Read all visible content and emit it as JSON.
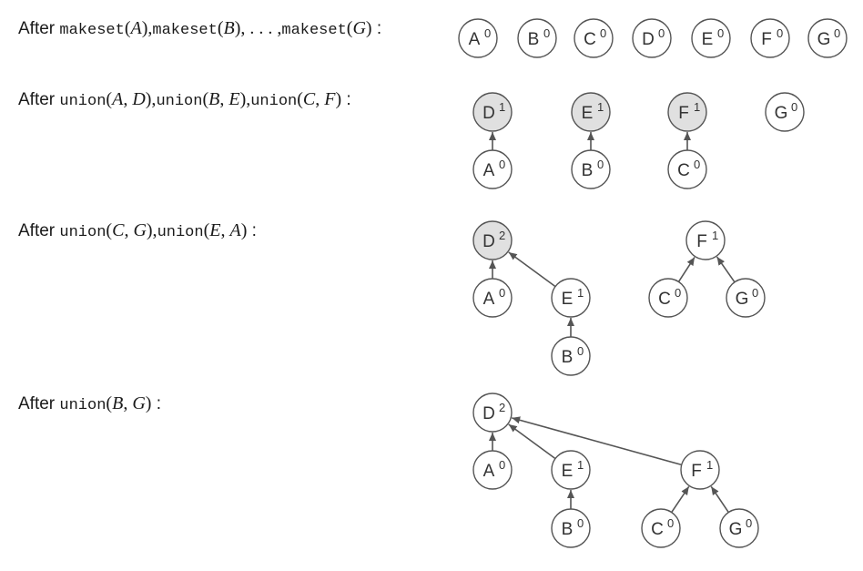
{
  "stages": [
    {
      "label_parts": [
        {
          "t": "After ",
          "s": "w"
        },
        {
          "t": "makeset",
          "s": "m"
        },
        {
          "t": "(",
          "s": "p"
        },
        {
          "t": "A",
          "s": "v"
        },
        {
          "t": "),",
          "s": "p"
        },
        {
          "t": "makeset",
          "s": "m"
        },
        {
          "t": "(",
          "s": "p"
        },
        {
          "t": "B",
          "s": "v"
        },
        {
          "t": "), . . . ,",
          "s": "p"
        },
        {
          "t": "makeset",
          "s": "m"
        },
        {
          "t": "(",
          "s": "p"
        },
        {
          "t": "G",
          "s": "v"
        },
        {
          "t": ")",
          "s": "p"
        },
        {
          "t": " :",
          "s": "w"
        }
      ],
      "nodes": [
        {
          "id": "A",
          "letter": "A",
          "rank": "0",
          "shaded": false
        },
        {
          "id": "B",
          "letter": "B",
          "rank": "0",
          "shaded": false
        },
        {
          "id": "C",
          "letter": "C",
          "rank": "0",
          "shaded": false
        },
        {
          "id": "D",
          "letter": "D",
          "rank": "0",
          "shaded": false
        },
        {
          "id": "E",
          "letter": "E",
          "rank": "0",
          "shaded": false
        },
        {
          "id": "F",
          "letter": "F",
          "rank": "0",
          "shaded": false
        },
        {
          "id": "G",
          "letter": "G",
          "rank": "0",
          "shaded": false
        }
      ],
      "edges": []
    },
    {
      "label_parts": [
        {
          "t": "After ",
          "s": "w"
        },
        {
          "t": "union",
          "s": "m"
        },
        {
          "t": "(",
          "s": "p"
        },
        {
          "t": "A",
          "s": "v"
        },
        {
          "t": ", ",
          "s": "p"
        },
        {
          "t": "D",
          "s": "v"
        },
        {
          "t": "),",
          "s": "p"
        },
        {
          "t": "union",
          "s": "m"
        },
        {
          "t": "(",
          "s": "p"
        },
        {
          "t": "B",
          "s": "v"
        },
        {
          "t": ", ",
          "s": "p"
        },
        {
          "t": "E",
          "s": "v"
        },
        {
          "t": "),",
          "s": "p"
        },
        {
          "t": "union",
          "s": "m"
        },
        {
          "t": "(",
          "s": "p"
        },
        {
          "t": "C",
          "s": "v"
        },
        {
          "t": ", ",
          "s": "p"
        },
        {
          "t": "F",
          "s": "v"
        },
        {
          "t": ")",
          "s": "p"
        },
        {
          "t": " :",
          "s": "w"
        }
      ],
      "nodes": [
        {
          "id": "D",
          "letter": "D",
          "rank": "1",
          "shaded": true
        },
        {
          "id": "E",
          "letter": "E",
          "rank": "1",
          "shaded": true
        },
        {
          "id": "F",
          "letter": "F",
          "rank": "1",
          "shaded": true
        },
        {
          "id": "G",
          "letter": "G",
          "rank": "0",
          "shaded": false
        },
        {
          "id": "A",
          "letter": "A",
          "rank": "0",
          "shaded": false
        },
        {
          "id": "B",
          "letter": "B",
          "rank": "0",
          "shaded": false
        },
        {
          "id": "C",
          "letter": "C",
          "rank": "0",
          "shaded": false
        }
      ],
      "edges": [
        {
          "from": "A",
          "to": "D"
        },
        {
          "from": "B",
          "to": "E"
        },
        {
          "from": "C",
          "to": "F"
        }
      ]
    },
    {
      "label_parts": [
        {
          "t": "After ",
          "s": "w"
        },
        {
          "t": "union",
          "s": "m"
        },
        {
          "t": "(",
          "s": "p"
        },
        {
          "t": "C",
          "s": "v"
        },
        {
          "t": ", ",
          "s": "p"
        },
        {
          "t": "G",
          "s": "v"
        },
        {
          "t": "),",
          "s": "p"
        },
        {
          "t": "union",
          "s": "m"
        },
        {
          "t": "(",
          "s": "p"
        },
        {
          "t": "E",
          "s": "v"
        },
        {
          "t": ", ",
          "s": "p"
        },
        {
          "t": "A",
          "s": "v"
        },
        {
          "t": ")",
          "s": "p"
        },
        {
          "t": " :",
          "s": "w"
        }
      ],
      "nodes": [
        {
          "id": "D",
          "letter": "D",
          "rank": "2",
          "shaded": true
        },
        {
          "id": "A",
          "letter": "A",
          "rank": "0",
          "shaded": false
        },
        {
          "id": "E",
          "letter": "E",
          "rank": "1",
          "shaded": false
        },
        {
          "id": "B",
          "letter": "B",
          "rank": "0",
          "shaded": false
        },
        {
          "id": "F",
          "letter": "F",
          "rank": "1",
          "shaded": false
        },
        {
          "id": "C",
          "letter": "C",
          "rank": "0",
          "shaded": false
        },
        {
          "id": "G",
          "letter": "G",
          "rank": "0",
          "shaded": false
        }
      ],
      "edges": [
        {
          "from": "A",
          "to": "D"
        },
        {
          "from": "E",
          "to": "D"
        },
        {
          "from": "B",
          "to": "E"
        },
        {
          "from": "C",
          "to": "F"
        },
        {
          "from": "G",
          "to": "F"
        }
      ]
    },
    {
      "label_parts": [
        {
          "t": "After ",
          "s": "w"
        },
        {
          "t": "union",
          "s": "m"
        },
        {
          "t": "(",
          "s": "p"
        },
        {
          "t": "B",
          "s": "v"
        },
        {
          "t": ", ",
          "s": "p"
        },
        {
          "t": "G",
          "s": "v"
        },
        {
          "t": ")",
          "s": "p"
        },
        {
          "t": " :",
          "s": "w"
        }
      ],
      "nodes": [
        {
          "id": "D",
          "letter": "D",
          "rank": "2",
          "shaded": false
        },
        {
          "id": "A",
          "letter": "A",
          "rank": "0",
          "shaded": false
        },
        {
          "id": "E",
          "letter": "E",
          "rank": "1",
          "shaded": false
        },
        {
          "id": "B",
          "letter": "B",
          "rank": "0",
          "shaded": false
        },
        {
          "id": "F",
          "letter": "F",
          "rank": "1",
          "shaded": false
        },
        {
          "id": "C",
          "letter": "C",
          "rank": "0",
          "shaded": false
        },
        {
          "id": "G",
          "letter": "G",
          "rank": "0",
          "shaded": false
        }
      ],
      "edges": [
        {
          "from": "A",
          "to": "D"
        },
        {
          "from": "E",
          "to": "D"
        },
        {
          "from": "F",
          "to": "D"
        },
        {
          "from": "B",
          "to": "E"
        },
        {
          "from": "C",
          "to": "F"
        },
        {
          "from": "G",
          "to": "F"
        }
      ]
    }
  ],
  "colors": {
    "node_stroke": "#555555",
    "node_fill": "#ffffff",
    "node_shaded_fill": "#e0e0e0",
    "edge": "#555555",
    "text": "#1a1a1a"
  }
}
